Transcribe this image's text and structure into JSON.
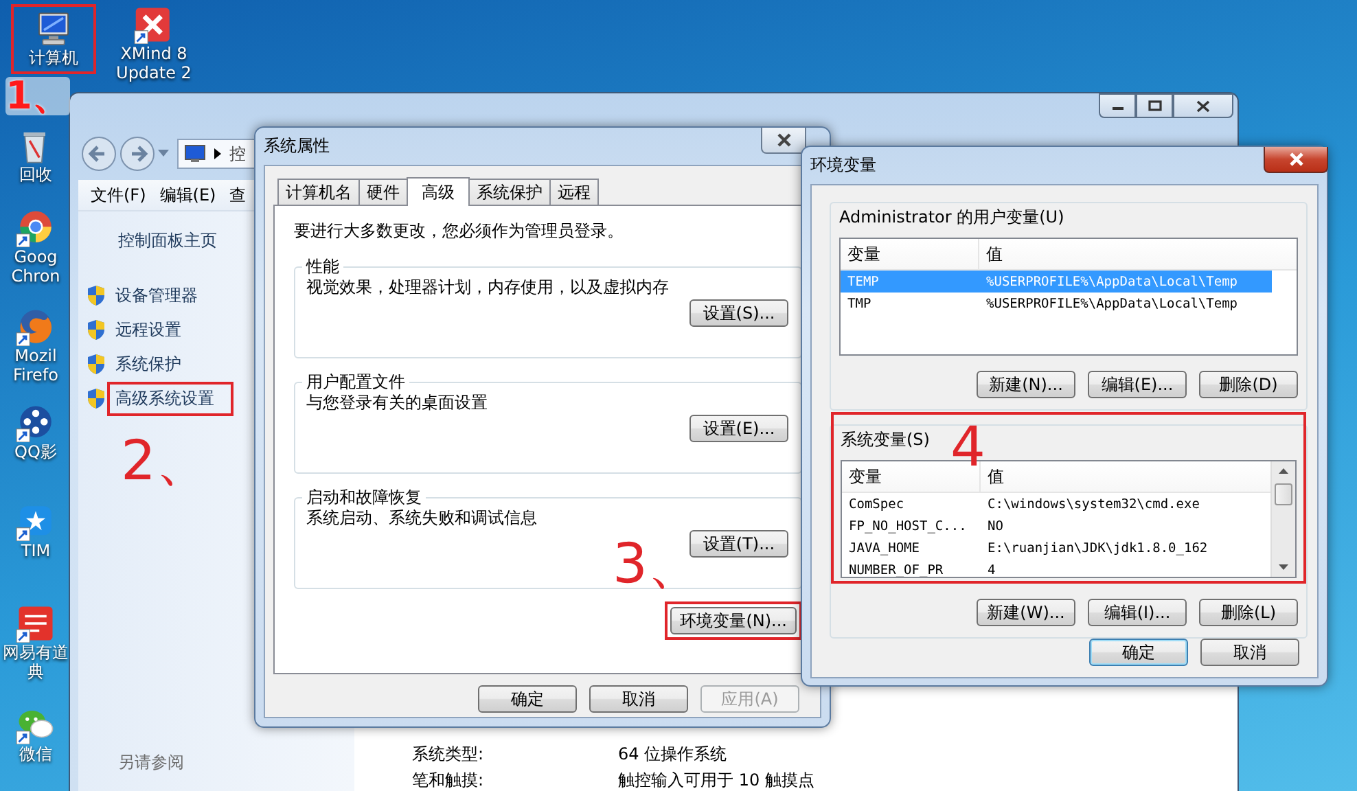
{
  "desktop_icons": [
    {
      "kind": "computer",
      "lines": [
        "计算机"
      ],
      "highlighted": true
    },
    {
      "kind": "xmind",
      "lines": [
        "XMind 8",
        "Update 2"
      ],
      "highlighted": false
    },
    {
      "kind": "recycle-bin",
      "lines": [
        "回收"
      ],
      "highlighted": false
    },
    {
      "kind": "chrome",
      "lines": [
        "Goog",
        "Chron"
      ],
      "highlighted": false
    },
    {
      "kind": "firefox",
      "lines": [
        "Mozil",
        "Firefo"
      ],
      "highlighted": false
    },
    {
      "kind": "player",
      "lines": [
        "QQ影"
      ],
      "highlighted": false
    },
    {
      "kind": "tim",
      "lines": [
        "TIM"
      ],
      "highlighted": false
    },
    {
      "kind": "dictionary",
      "lines": [
        "网易有道",
        "典"
      ],
      "highlighted": false
    },
    {
      "kind": "wechat",
      "lines": [
        "微信"
      ],
      "highlighted": false
    }
  ],
  "annotations": [
    {
      "label": "1、"
    },
    {
      "label": "2、"
    },
    {
      "label": "3、"
    },
    {
      "label": "4"
    }
  ],
  "control_panel": {
    "address": "控",
    "menu": [
      "文件(F)",
      "编辑(E)",
      "查"
    ],
    "sidebar": {
      "home": "控制面板主页",
      "items": [
        {
          "label": "设备管理器",
          "highlighted": false
        },
        {
          "label": "远程设置",
          "highlighted": false
        },
        {
          "label": "系统保护",
          "highlighted": false
        },
        {
          "label": "高级系统设置",
          "highlighted": true
        }
      ],
      "see_also": "另请参阅"
    },
    "details": [
      {
        "label": "系统类型:",
        "value": "64 位操作系统"
      },
      {
        "label": "笔和触摸:",
        "value": "触控输入可用于 10 触摸点"
      }
    ]
  },
  "system_properties": {
    "title": "系统属性",
    "tabs": [
      {
        "label": "计算机名",
        "selected": false
      },
      {
        "label": "硬件",
        "selected": false
      },
      {
        "label": "高级",
        "selected": true
      },
      {
        "label": "系统保护",
        "selected": false
      },
      {
        "label": "远程",
        "selected": false
      }
    ],
    "message": "要进行大多数更改，您必须作为管理员登录。",
    "groups": [
      {
        "title": "性能",
        "description": "视觉效果，处理器计划，内存使用，以及虚拟内存",
        "button": "设置(S)..."
      },
      {
        "title": "用户配置文件",
        "description": "与您登录有关的桌面设置",
        "button": "设置(E)..."
      },
      {
        "title": "启动和故障恢复",
        "description": "系统启动、系统失败和调试信息",
        "button": "设置(T)..."
      }
    ],
    "env_button": {
      "label": "环境变量(N)...",
      "highlighted": true
    },
    "buttons": [
      {
        "label": "确定",
        "disabled": false
      },
      {
        "label": "取消",
        "disabled": false
      },
      {
        "label": "应用(A)",
        "disabled": true
      }
    ]
  },
  "environment_variables": {
    "title": "环境变量",
    "user_group": {
      "title": "Administrator 的用户变量(U)",
      "highlighted": false,
      "columns": [
        "变量",
        "值"
      ],
      "rows": [
        {
          "name": "TEMP",
          "value": "%USERPROFILE%\\AppData\\Local\\Temp",
          "selected": true
        },
        {
          "name": "TMP",
          "value": "%USERPROFILE%\\AppData\\Local\\Temp",
          "selected": false
        }
      ],
      "buttons": [
        "新建(N)...",
        "编辑(E)...",
        "删除(D)"
      ]
    },
    "system_group": {
      "title": "系统变量(S)",
      "highlighted": true,
      "columns": [
        "变量",
        "值"
      ],
      "rows": [
        {
          "name": "ComSpec",
          "value": "C:\\windows\\system32\\cmd.exe",
          "selected": false
        },
        {
          "name": "FP_NO_HOST_C...",
          "value": "NO",
          "selected": false
        },
        {
          "name": "JAVA_HOME",
          "value": "E:\\ruanjian\\JDK\\jdk1.8.0_162",
          "selected": false
        },
        {
          "name": "NUMBER_OF_PR",
          "value": "4",
          "selected": false
        }
      ],
      "buttons": [
        "新建(W)...",
        "编辑(I)...",
        "删除(L)"
      ]
    },
    "buttons": [
      {
        "label": "确定",
        "default": true
      },
      {
        "label": "取消",
        "default": false
      }
    ]
  }
}
